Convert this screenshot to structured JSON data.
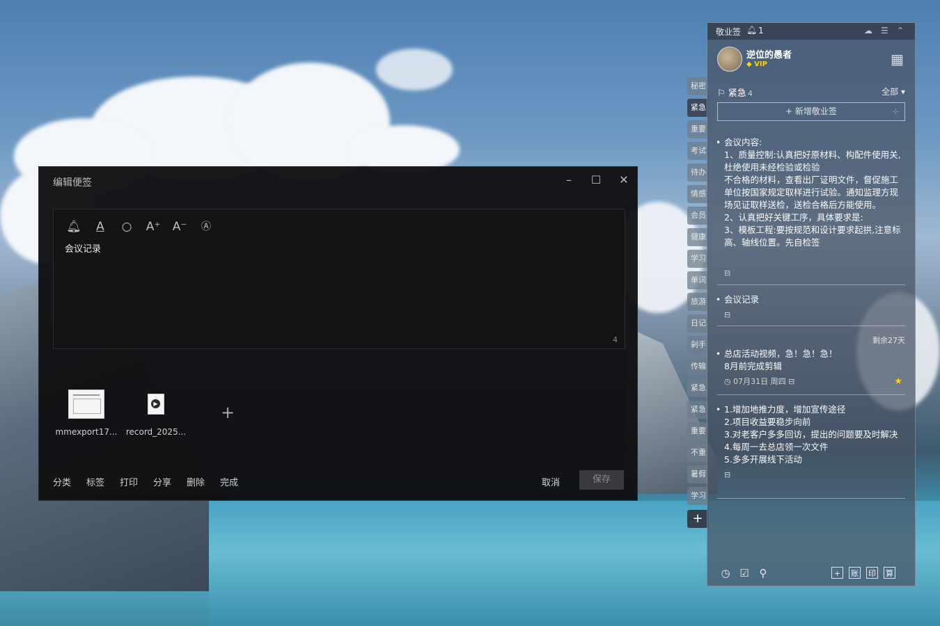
{
  "editor": {
    "title": "编辑便签",
    "note_text": "会议记录",
    "char_count": "4",
    "attachments": [
      {
        "name": "mmexport17..."
      },
      {
        "name": "record_2025..."
      }
    ],
    "actions": [
      "分类",
      "标签",
      "打印",
      "分享",
      "删除",
      "完成"
    ],
    "cancel_label": "取消",
    "save_label": "保存"
  },
  "panel": {
    "app_name": "敬业签",
    "reminder_count": "1",
    "user": {
      "name": "逆位的愚者",
      "vip": "VIP"
    },
    "category": {
      "name": "紧急",
      "count": "4"
    },
    "filter": "全部",
    "add_note_label": "新增敬业签",
    "tabs": [
      "秘密",
      "紧急",
      "重要",
      "考试",
      "待办",
      "情感",
      "会员",
      "健康",
      "学习",
      "单词",
      "旅游",
      "日记",
      "剁手",
      "传输",
      "紧急",
      "紧急",
      "重要",
      "不重",
      "暑假",
      "学习"
    ],
    "notes": [
      {
        "lines": [
          "会议内容:",
          "1、质量控制:认真把好原材料、构配件使用关,杜绝使用未经检验或检验",
          "不合格的材料，查看出厂证明文件，督促施工单位按国家规定取样进行试验。通知监理方现场见证取样送检，送检合格后方能使用。",
          "2、认真把好关键工序，具体要求是:",
          "3、模板工程:要按规范和设计要求起拱,注意标高、轴线位置。先自检签"
        ]
      },
      {
        "lines": [
          "会议记录"
        ]
      },
      {
        "remaining": "剩余27天",
        "lines": [
          "总店活动视频，急！急！急！",
          "8月前完成剪辑"
        ],
        "date": "07月31日 周四"
      },
      {
        "lines": [
          "1.增加地推力度，增加宣传途径",
          "2.项目收益要稳步向前",
          "3.对老客户多多回访，提出的问题要及时解决",
          "4.每周一去总店领一次文件",
          "5.多多开展线下活动"
        ]
      }
    ],
    "footer_boxes": [
      "+",
      "账",
      "印",
      "算"
    ]
  }
}
